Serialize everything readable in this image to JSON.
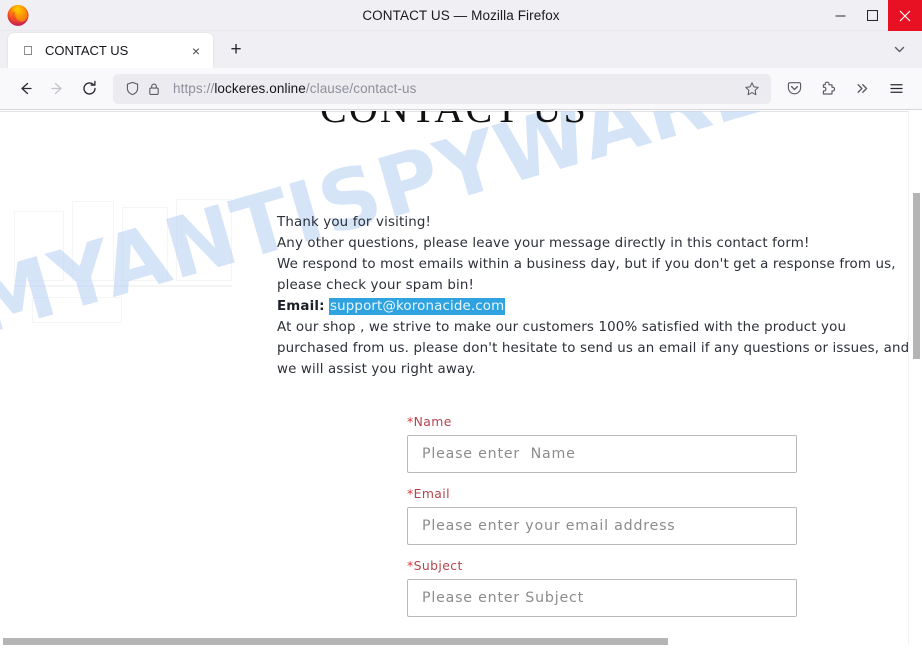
{
  "window": {
    "title": "CONTACT US — Mozilla Firefox",
    "minimize_label": "Minimize",
    "maximize_label": "Maximize",
    "close_label": "Close"
  },
  "tabs": {
    "items": [
      {
        "title": "CONTACT US",
        "favicon": "apple-icon",
        "close_label": "×"
      }
    ],
    "new_tab_label": "+",
    "list_all_tabs_label": "List all tabs"
  },
  "toolbar": {
    "back_label": "Back",
    "forward_label": "Forward",
    "reload_label": "Reload",
    "shield_label": "Tracking protection",
    "lock_label": "Connection secure",
    "url": {
      "scheme": "https://",
      "host": "lockeres.online",
      "path": "/clause/contact-us",
      "full": "https://lockeres.online/clause/contact-us"
    },
    "bookmark_label": "Bookmark this page",
    "pocket_label": "Save to Pocket",
    "extensions_label": "Extensions",
    "overflow_label": "More tools",
    "menu_label": "Open application menu"
  },
  "page": {
    "heading": "CONTACT US",
    "watermark": "MYANTISPYWARE.COM",
    "paragraphs": [
      "Thank you for visiting!",
      "Any other questions, please leave your message directly in this contact form!",
      "We respond to most emails within a business day, but if you don't get a response from us, please check your spam bin!"
    ],
    "email_label": "Email:",
    "email_address": "support@koronacide.com",
    "closing_paragraph": "At our shop , we strive to make our customers 100% satisfied with the product you purchased from us. please don't hesitate to send us an email if any questions or issues, and we will assist you right away.",
    "form": {
      "fields": [
        {
          "required_mark": "*",
          "label": "Name",
          "placeholder": "Please enter  Name",
          "value": ""
        },
        {
          "required_mark": "*",
          "label": "Email",
          "placeholder": "Please enter your email address",
          "value": ""
        },
        {
          "required_mark": "*",
          "label": "Subject",
          "placeholder": "Please enter Subject",
          "value": ""
        }
      ]
    }
  },
  "colors": {
    "close_button": "#e81123",
    "selection_highlight": "#2ea3e0",
    "required_label": "#b4444c",
    "watermark": "#bdd4f5"
  }
}
